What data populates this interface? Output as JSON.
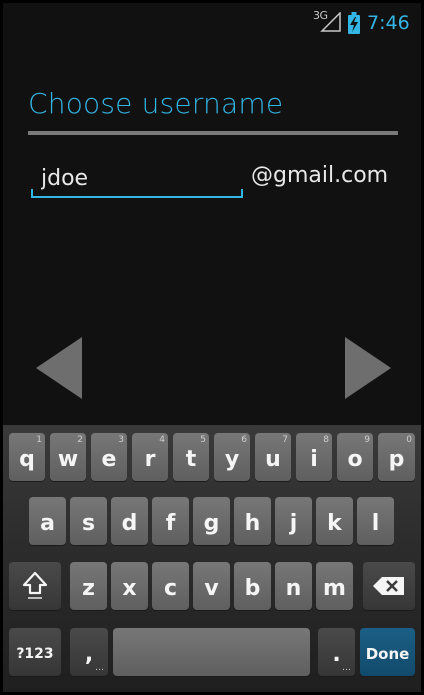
{
  "status_bar": {
    "network": "3G",
    "time": "7:46",
    "accent": "#33b5e5"
  },
  "page": {
    "title": "Choose username"
  },
  "form": {
    "username_value": "jdoe",
    "domain": "@gmail.com"
  },
  "navigation": {
    "prev_icon": "left-triangle-icon",
    "next_icon": "right-triangle-icon"
  },
  "keyboard": {
    "row1": [
      {
        "key": "q",
        "hint": "1"
      },
      {
        "key": "w",
        "hint": "2"
      },
      {
        "key": "e",
        "hint": "3"
      },
      {
        "key": "r",
        "hint": "4"
      },
      {
        "key": "t",
        "hint": "5"
      },
      {
        "key": "y",
        "hint": "6"
      },
      {
        "key": "u",
        "hint": "7"
      },
      {
        "key": "i",
        "hint": "8"
      },
      {
        "key": "o",
        "hint": "9"
      },
      {
        "key": "p",
        "hint": "0"
      }
    ],
    "row2": [
      "a",
      "s",
      "d",
      "f",
      "g",
      "h",
      "j",
      "k",
      "l"
    ],
    "row3": [
      "z",
      "x",
      "c",
      "v",
      "b",
      "n",
      "m"
    ],
    "symbols_label": "?123",
    "comma_label": ",",
    "period_label": ".",
    "done_label": "Done",
    "done_color": "#1b5f86",
    "shift_icon": "shift-icon",
    "backspace_icon": "backspace-icon"
  }
}
